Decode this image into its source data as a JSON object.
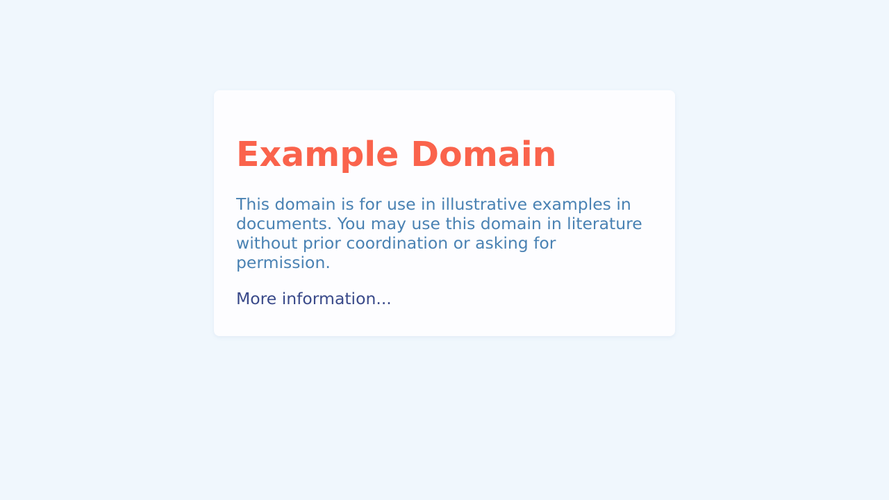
{
  "page": {
    "title": "Example Domain",
    "description": "This domain is for use in illustrative examples in documents. You may use this domain in literature without prior coordination or asking for permission.",
    "more_link": "More information..."
  },
  "colors": {
    "background": "#f0f7fd",
    "card": "#fdfdff",
    "title": "#fa634c",
    "description": "#4a82b3",
    "link": "#3a4a8a"
  }
}
